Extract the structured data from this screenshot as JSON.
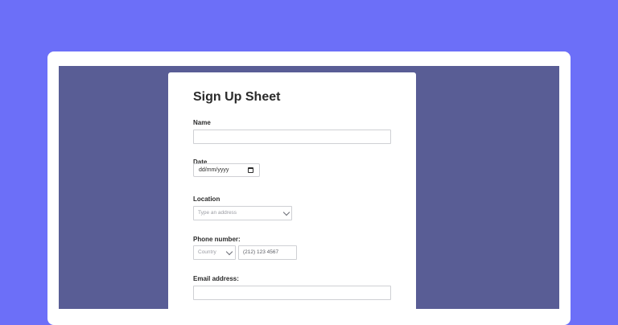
{
  "form": {
    "title": "Sign Up Sheet",
    "name": {
      "label": "Name",
      "value": ""
    },
    "date": {
      "label": "Date",
      "value": "dd/mm/yyyy"
    },
    "location": {
      "label": "Location",
      "placeholder": "Type an address"
    },
    "phone": {
      "label": "Phone number:",
      "country_placeholder": "Country",
      "number_placeholder": "(212) 123 4567"
    },
    "email": {
      "label": "Email address:",
      "value": ""
    }
  },
  "icons": {
    "date_picker": "calendar-icon",
    "location_dropdown": "chevron-down-icon",
    "country_dropdown": "chevron-down-icon"
  },
  "colors": {
    "background": "#6c6ff8",
    "viewport": "#595d95",
    "card": "#ffffff",
    "input_border": "#cfd0d4"
  }
}
